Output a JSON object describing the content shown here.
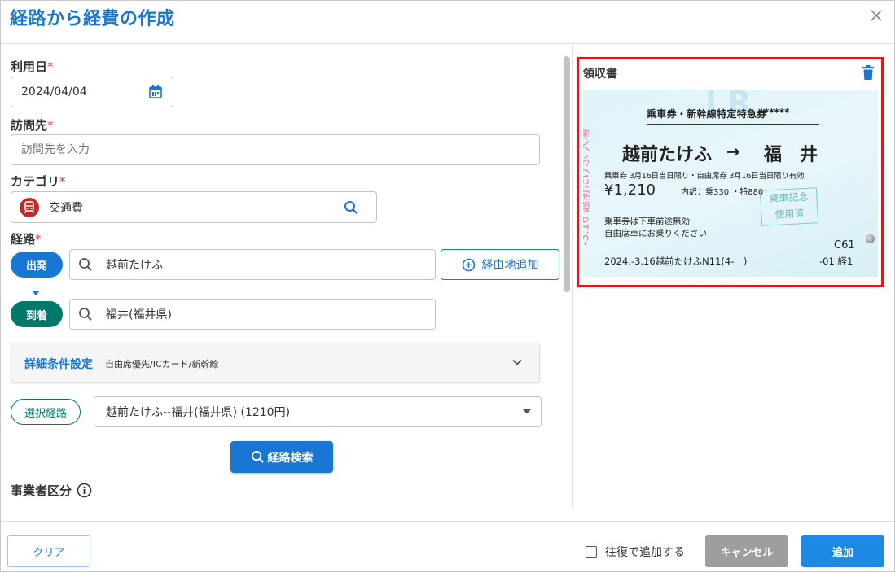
{
  "dialog": {
    "title": "経路から経費の作成"
  },
  "form": {
    "date": {
      "label": "利用日",
      "required_mark": "*",
      "value": "2024/04/04"
    },
    "destination": {
      "label": "訪問先",
      "required_mark": "*",
      "placeholder": "訪問先を入力"
    },
    "category": {
      "label": "カテゴリ",
      "required_mark": "*",
      "value": "交通費"
    },
    "route": {
      "label": "経路",
      "required_mark": "*",
      "departure_label": "出発",
      "departure_value": "越前たけふ",
      "add_via_label": "経由地追加",
      "arrival_label": "到着",
      "arrival_value": "福井(福井県)"
    },
    "advanced": {
      "title": "詳細条件設定",
      "summary": "自由席優先/ICカード/新幹線"
    },
    "selected_route": {
      "label": "選択経路",
      "value": "越前たけふ--福井(福井県) (1210円)"
    },
    "search_button": "経路検索",
    "business_type": {
      "label": "事業者区分"
    }
  },
  "receipt": {
    "label": "領収書",
    "ticket": {
      "header": "乗車券・新幹線特定特急券",
      "stars": "*****",
      "from": "越前たけふ",
      "arrow": "→",
      "to": "福　井",
      "validity": "乗車券 3月16日当日限り・自由席券 3月16日当日限り有効",
      "fare": "¥1,210",
      "breakdown": "内訳：乗330 ・特880",
      "stamp_top": "乗車記念",
      "stamp_bottom": "使用済",
      "note1": "乗車券は下車前途無効",
      "note2": "自由席車にお乗りください",
      "code": "C61",
      "issue": "2024.-3.16越前たけふN11(4-　)",
      "serial": "-01 経1",
      "side_text": "-3.16 越前たけふ 入場"
    }
  },
  "footer": {
    "clear": "クリア",
    "roundtrip": "往復で追加する",
    "cancel": "キャンセル",
    "add": "追加"
  },
  "colors": {
    "primary": "#1976d2",
    "green": "#00796b",
    "required": "#e53935",
    "highlight_border": "#e0161e"
  }
}
